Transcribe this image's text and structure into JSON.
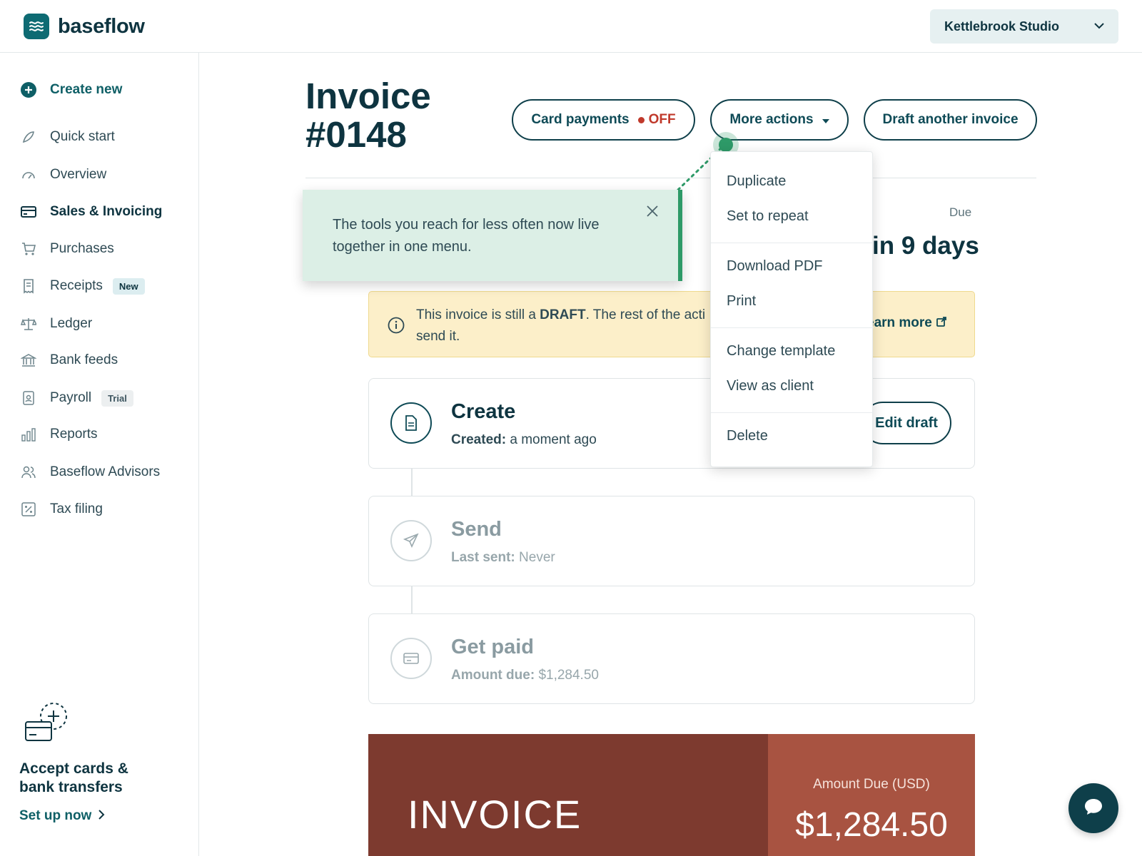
{
  "app": {
    "name": "baseflow"
  },
  "company": {
    "name": "Kettlebrook Studio"
  },
  "sidebar": {
    "create_label": "Create new",
    "items": [
      {
        "label": "Quick start"
      },
      {
        "label": "Overview"
      },
      {
        "label": "Sales & Invoicing"
      },
      {
        "label": "Purchases"
      },
      {
        "label": "Receipts",
        "badge": "New"
      },
      {
        "label": "Ledger"
      },
      {
        "label": "Bank feeds"
      },
      {
        "label": "Payroll",
        "badge": "Trial"
      },
      {
        "label": "Reports"
      },
      {
        "label": "Baseflow Advisors"
      },
      {
        "label": "Tax filing"
      }
    ],
    "promo": {
      "title_line1": "Accept cards &",
      "title_line2": "bank transfers",
      "link": "Set up now"
    }
  },
  "header": {
    "title_line1": "Invoice",
    "title_line2": "#0148",
    "card_payments_label": "Card payments",
    "card_payments_state": "OFF",
    "more_actions_label": "More actions",
    "draft_another_label": "Draft another invoice"
  },
  "due": {
    "label": "Due",
    "value": "in 9 days"
  },
  "notice": {
    "text_before": "This invoice is still a ",
    "text_bold": "DRAFT",
    "text_after": ". The rest of the acti",
    "text_line2": "send it.",
    "learn_more": "earn more"
  },
  "steps": [
    {
      "title": "Create",
      "sub_label": "Created:",
      "sub_value": "a moment ago",
      "action": "Edit draft"
    },
    {
      "title": "Send",
      "sub_label": "Last sent:",
      "sub_value": "Never"
    },
    {
      "title": "Get paid",
      "sub_label": "Amount due:",
      "sub_value": "$1,284.50"
    }
  ],
  "preview": {
    "word": "INVOICE",
    "amount_label": "Amount Due (USD)",
    "amount": "$1,284.50"
  },
  "tooltip": {
    "text": "The tools you reach for less often now live together in one menu."
  },
  "menu": {
    "items": [
      "Duplicate",
      "Set to repeat",
      "Download PDF",
      "Print",
      "Change template",
      "View as client",
      "Delete"
    ]
  },
  "colors": {
    "brand": "#0e6b73",
    "dark": "#0e3440",
    "accent_green": "#2e9a68",
    "off_red": "#c0392b",
    "draft_bg": "#fcefc9",
    "invoice_dark": "#7d3a2f",
    "invoice_light": "#a85341"
  }
}
